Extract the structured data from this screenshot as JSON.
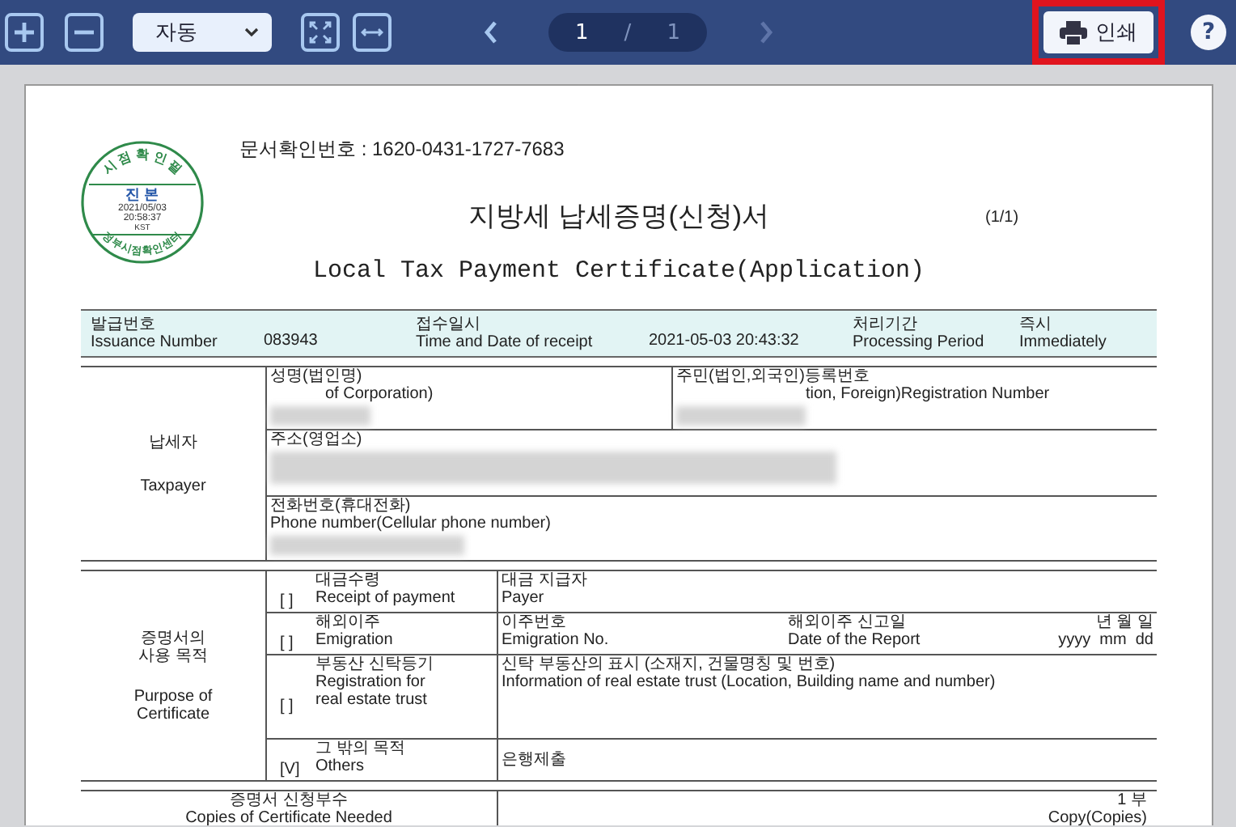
{
  "toolbar": {
    "zoom_select": "자동",
    "page_current": "1",
    "page_separator": "/",
    "page_total": "1",
    "print": {
      "label": "인쇄",
      "highlighted": true
    },
    "help": "?"
  },
  "document": {
    "verification": "문서확인번호 : 1620-0431-1727-7683",
    "stamp": {
      "top": "시 점 확 인 필",
      "seal": "진 본",
      "date": "2021/05/03",
      "time": "20:58:37",
      "zone": "KST",
      "bottom": "정부시점확인센터"
    },
    "title_ko": "지방세 납세증명(신청)서",
    "title_en": "Local Tax Payment Certificate(Application)",
    "page_marker": "(1/1)",
    "header_row": [
      {
        "label_ko": "발급번호",
        "label_en": "Issuance Number",
        "value": "083943"
      },
      {
        "label_ko": "접수일시",
        "label_en": "Time and Date of receipt",
        "value": "2021-05-03 20:43:32"
      },
      {
        "label_ko": "처리기간",
        "label_en": "Processing Period",
        "value_ko": "즉시",
        "value": "Immediately"
      }
    ],
    "taxpayer": {
      "label_ko": "납세자",
      "label_en": "Taxpayer",
      "name": {
        "label_ko": "성명(법인명)",
        "label_en": "of Corporation)"
      },
      "registration": {
        "label_ko": "주민(법인,외국인)등록번호",
        "label_en": "tion, Foreign)Registration Number"
      },
      "address": {
        "label_ko": "주소(영업소)"
      },
      "phone": {
        "label_ko": "전화번호(휴대전화)",
        "label_en": "Phone number(Cellular phone number)"
      }
    },
    "purpose": {
      "label_ko": "증명서의\n사용 목적",
      "label_en": "Purpose of\nCertificate",
      "options": [
        {
          "mark": "[ ]",
          "label_ko": "대금수령",
          "label_en": "Receipt of payment",
          "details": [
            {
              "ko": "대금 지급자",
              "en": "Payer"
            }
          ]
        },
        {
          "mark": "[ ]",
          "label_ko": "해외이주",
          "label_en": "Emigration",
          "details": [
            {
              "ko": "이주번호",
              "en": "Emigration No."
            },
            {
              "ko": "해외이주 신고일",
              "en": "Date of the Report"
            },
            {
              "ko": "년 월 일",
              "en": "yyyy  mm  dd"
            }
          ]
        },
        {
          "mark": "[ ]",
          "label_ko": "부동산 신탁등기",
          "label_en": "Registration for\nreal estate trust",
          "details": [
            {
              "ko": "신탁 부동산의 표시 (소재지, 건물명칭 및 번호)",
              "en": "Information of real estate trust (Location, Building name and number)"
            }
          ]
        },
        {
          "mark": "[V]",
          "label_ko": "그 밖의 목적",
          "label_en": "Others",
          "details": [
            {
              "ko": "은행제출"
            }
          ]
        }
      ]
    },
    "copies": {
      "label_ko": "증명서 신청부수",
      "label_en": "Copies of Certificate Needed",
      "value_ko": "1 부",
      "value_en": "Copy(Copies)"
    }
  }
}
